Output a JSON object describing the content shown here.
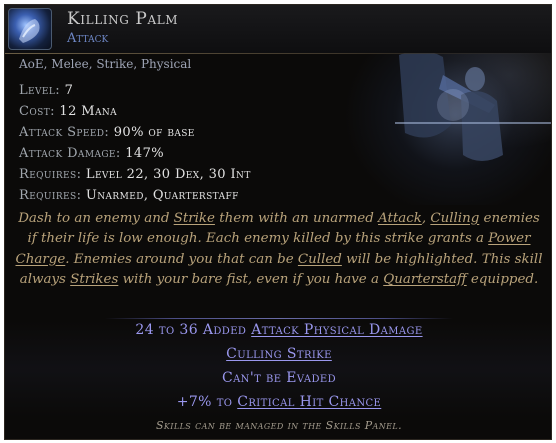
{
  "skill": {
    "name": "Killing Palm",
    "type": "Attack",
    "icon": "killing-palm-icon",
    "tags": "AoE, Melee, Strike, Physical"
  },
  "stats": [
    {
      "label": "Level: ",
      "value": "7"
    },
    {
      "label": "Cost: ",
      "value": "12 Mana"
    },
    {
      "label": "Attack Speed: ",
      "value": "90% of base"
    },
    {
      "label": "Attack Damage: ",
      "value": "147%"
    },
    {
      "label": "Requires: ",
      "value": "Level 22, 30 Dex, 30 Int"
    },
    {
      "label": "Requires: ",
      "value": "Unarmed, Quarterstaff"
    }
  ],
  "description": [
    {
      "t": "Dash to an enemy and ",
      "u": false
    },
    {
      "t": "Strike",
      "u": true
    },
    {
      "t": " them with an unarmed ",
      "u": false
    },
    {
      "t": "Attack",
      "u": true
    },
    {
      "t": ", ",
      "u": false
    },
    {
      "t": "Culling",
      "u": true
    },
    {
      "t": " enemies if their life is low enough. Each enemy killed by this strike grants a ",
      "u": false
    },
    {
      "t": "Power Charge",
      "u": true
    },
    {
      "t": ". Enemies around you that can be ",
      "u": false
    },
    {
      "t": "Culled",
      "u": true
    },
    {
      "t": " will be highlighted. This skill always ",
      "u": false
    },
    {
      "t": "Strikes",
      "u": true
    },
    {
      "t": " with your bare fist, even if you have a ",
      "u": false
    },
    {
      "t": "Quarterstaff",
      "u": true
    },
    {
      "t": " equipped.",
      "u": false
    }
  ],
  "mods": {
    "added_damage_prefix": "24 to 36 Added ",
    "added_damage_link": "Attack Physical Damage",
    "culling_strike": "Culling Strike",
    "cant_be_evaded": "Can't be Evaded",
    "crit_prefix": "+7% to ",
    "crit_link": "Critical Hit Chance"
  },
  "footer": "Skills can be managed in the Skills Panel.",
  "colors": {
    "title": "#c9c9c9",
    "subtitle": "#6f88c7",
    "description": "#b8a27a",
    "modifier": "#9a97ee"
  }
}
